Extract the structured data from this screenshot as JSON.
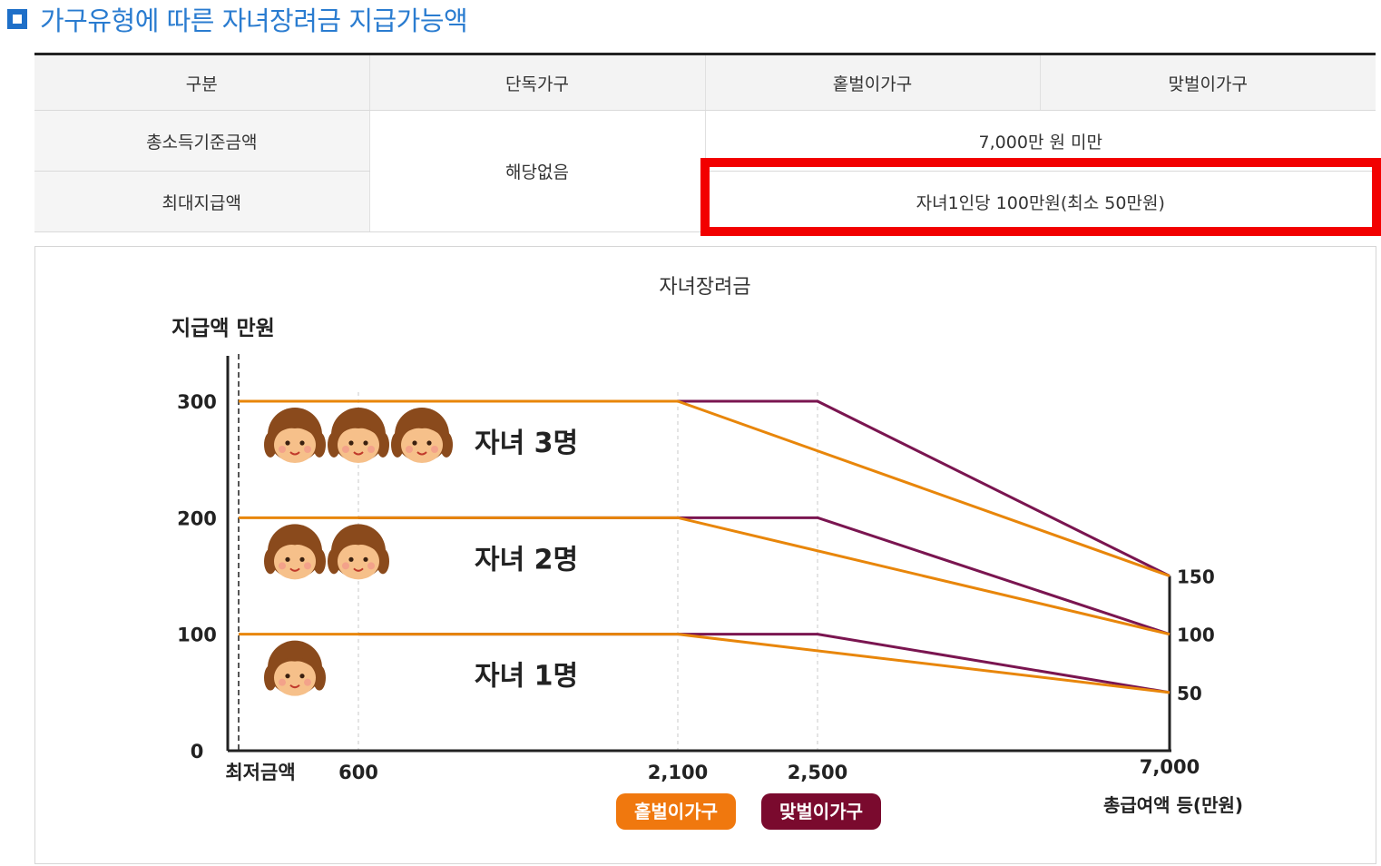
{
  "page": {
    "section_title": "가구유형에 따른 자녀장려금 지급가능액"
  },
  "table": {
    "headers": [
      "구분",
      "단독가구",
      "홑벌이가구",
      "맞벌이가구"
    ],
    "rows": [
      {
        "label": "총소득기준금액",
        "value": "7,000만 원 미만"
      },
      {
        "label": "최대지급액",
        "value": "자녀1인당 100만원(최소 50만원)"
      }
    ],
    "single_household_value": "해당없음"
  },
  "colors": {
    "title_blue": "#2a7cd0",
    "highlight_red": "#f20000",
    "single_earner": "#e8860a",
    "dual_earner": "#7a1550",
    "pill_single": "#f0780e",
    "pill_dual": "#7a0a2e",
    "axis": "#222222"
  },
  "chart_data": {
    "type": "line",
    "title": "자녀장려금",
    "ylabel": "지급액 만원",
    "xlabel": "총급여액 등(만원)",
    "x_ticks": [
      "최저금액",
      "600",
      "2,100",
      "2,500",
      "7,000"
    ],
    "y_ticks": [
      "0",
      "100",
      "200",
      "300"
    ],
    "right_ticks": [
      "150",
      "100",
      "50"
    ],
    "ylim": [
      0,
      300
    ],
    "grid": false,
    "legend": [
      "홑벌이가구",
      "맞벌이가구"
    ],
    "legend_placement": "bottom",
    "groups": [
      {
        "label": "자녀 3명",
        "faces": 3,
        "series": [
          {
            "name": "홑벌이가구",
            "points": [
              [
                "최저금액",
                300
              ],
              [
                "2,100",
                300
              ],
              [
                "7,000",
                150
              ]
            ]
          },
          {
            "name": "맞벌이가구",
            "points": [
              [
                "600",
                300
              ],
              [
                "2,500",
                300
              ],
              [
                "7,000",
                150
              ]
            ]
          }
        ]
      },
      {
        "label": "자녀 2명",
        "faces": 2,
        "series": [
          {
            "name": "홑벌이가구",
            "points": [
              [
                "최저금액",
                200
              ],
              [
                "2,100",
                200
              ],
              [
                "7,000",
                100
              ]
            ]
          },
          {
            "name": "맞벌이가구",
            "points": [
              [
                "600",
                200
              ],
              [
                "2,500",
                200
              ],
              [
                "7,000",
                100
              ]
            ]
          }
        ]
      },
      {
        "label": "자녀 1명",
        "faces": 1,
        "series": [
          {
            "name": "홑벌이가구",
            "points": [
              [
                "최저금액",
                100
              ],
              [
                "2,100",
                100
              ],
              [
                "7,000",
                50
              ]
            ]
          },
          {
            "name": "맞벌이가구",
            "points": [
              [
                "600",
                100
              ],
              [
                "2,500",
                100
              ],
              [
                "7,000",
                50
              ]
            ]
          }
        ]
      }
    ],
    "face_icon": "child-face-icon"
  }
}
